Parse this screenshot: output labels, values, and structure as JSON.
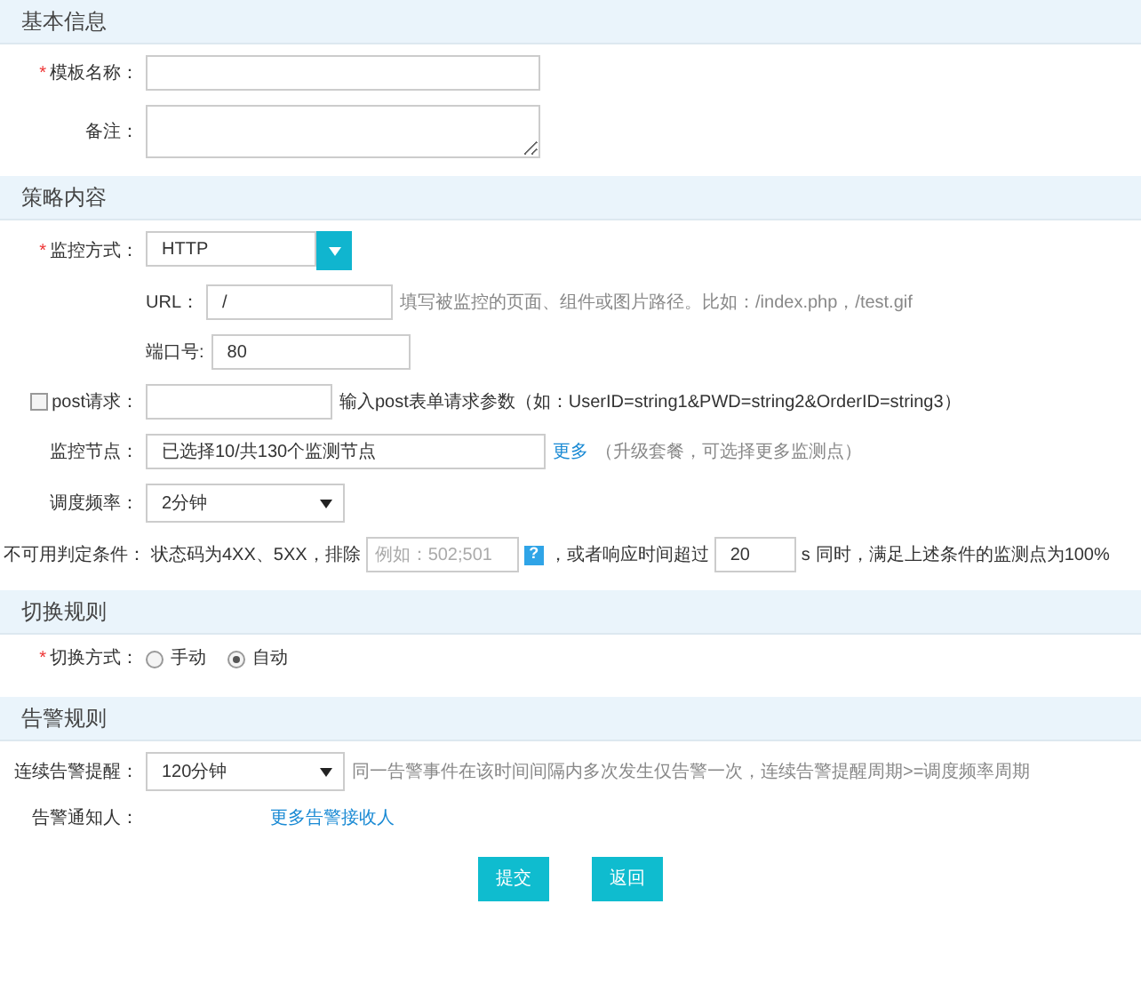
{
  "sections": [
    {
      "title": "基本信息",
      "fields": [
        {
          "kind": "input",
          "label": "模板名称：",
          "required_mark": "*"
        },
        {
          "kind": "textarea",
          "label": "备注："
        }
      ]
    },
    {
      "title": "策略内容",
      "fields": [
        {
          "kind": "combo",
          "label": "监控方式：",
          "required_mark": "*",
          "value": "HTTP"
        },
        {
          "kind": "subinput",
          "label": "URL：",
          "value": "/",
          "hint": "填写被监控的页面、组件或图片路径。比如：/index.php，/test.gif"
        },
        {
          "kind": "subinput",
          "label": "端口号:",
          "value": "80"
        },
        {
          "kind": "check",
          "label": "post请求：",
          "checked": false,
          "hint": "输入post表单请求参数（如：UserID=string1&PWD=string2&OrderID=string3）"
        },
        {
          "kind": "input",
          "label": "监控节点：",
          "value": "已选择10/共130个监测节点",
          "link": "更多",
          "hint": "（升级套餐，可选择更多监测点）"
        },
        {
          "kind": "select",
          "label": "调度频率：",
          "value": "2分钟"
        },
        {
          "kind": "condition",
          "label": "不可用判定条件：",
          "text_1": "状态码为4XX、5XX，排除",
          "placeholder": "例如：502;501",
          "help": "?",
          "text_2": "，或者响应时间超过",
          "value": "20",
          "text_3": "s",
          "text_4": "同时，满足上述条件的监测点为100%"
        }
      ]
    },
    {
      "title": "切换规则",
      "fields": [
        {
          "kind": "radio",
          "label": "切换方式：",
          "required_mark": "*",
          "options": [
            {
              "label": "手动",
              "selected": false
            },
            {
              "label": "自动",
              "selected": true
            }
          ]
        }
      ]
    },
    {
      "title": "告警规则",
      "fields": [
        {
          "kind": "select",
          "label": "连续告警提醒：",
          "value": "120分钟",
          "hint": "同一告警事件在该时间间隔内多次发生仅告警一次，连续告警提醒周期>=调度频率周期"
        },
        {
          "kind": "link",
          "label": "告警通知人：",
          "link": "更多告警接收人"
        }
      ]
    }
  ],
  "buttons": [
    "提交",
    "返回"
  ]
}
